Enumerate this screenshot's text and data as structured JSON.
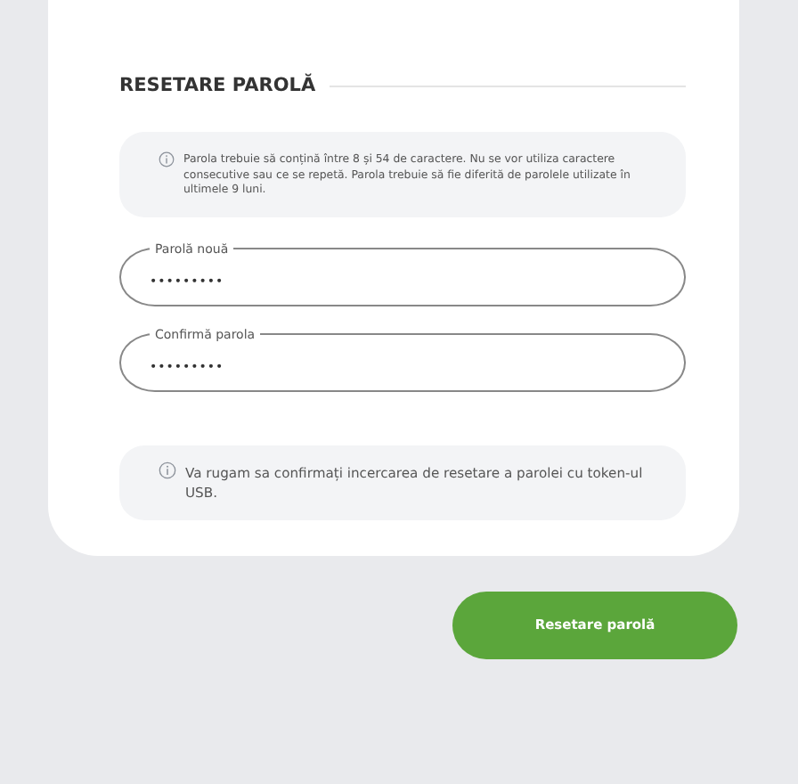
{
  "title": "RESETARE PAROLĂ",
  "notice": "Parola trebuie să conțină între 8 și 54 de caractere. Nu se vor utiliza caractere consecutive sau ce se repetă. Parola trebuie să fie diferită de parolele utilizate în ultimele 9 luni.",
  "fields": [
    {
      "label": "Parolă nouă",
      "value": "•••••••••"
    },
    {
      "label": "Confirmă parola",
      "value": "•••••••••"
    }
  ],
  "token_notice": "Va rugam sa confirmați incercarea de resetare a parolei cu token-ul USB.",
  "button": "Resetare parolă"
}
